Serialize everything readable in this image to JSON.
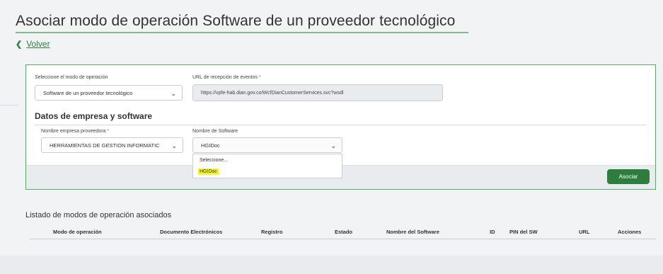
{
  "page": {
    "title": "Asociar modo de operación Software de un proveedor tecnológico",
    "back_label": "Volver"
  },
  "form": {
    "mode_label": "Seleccione el modo de operación",
    "mode_value": "Software de un proveedor tecnológico",
    "url_label": "URL de recepción de eventos",
    "url_required": "*",
    "url_value": "https://vpfe-hab.dian.gov.co/WcfDianCustomerServices.svc?wsdl",
    "section_title": "Datos de empresa y software",
    "provider_label": "Nombre empresa proveedora",
    "provider_required": "*",
    "provider_value": "HERRAMIENTAS DE GESTION INFORMATIC",
    "software_label": "Nombre de Software",
    "software_value": "HGIDoc",
    "software_options": [
      "Seleccione...",
      "HGIDoc"
    ],
    "submit_label": "Asociar"
  },
  "list": {
    "title": "Listado de modos de operación asociados",
    "columns": [
      "Modo de operación",
      "Documento Electrónicos",
      "Registro",
      "Estado",
      "Nombre del Software",
      "ID",
      "PIN del SW",
      "URL",
      "Acciones"
    ]
  },
  "colors": {
    "accent": "#2e7d3e",
    "highlight": "#f5f533",
    "required": "#d9534f"
  }
}
